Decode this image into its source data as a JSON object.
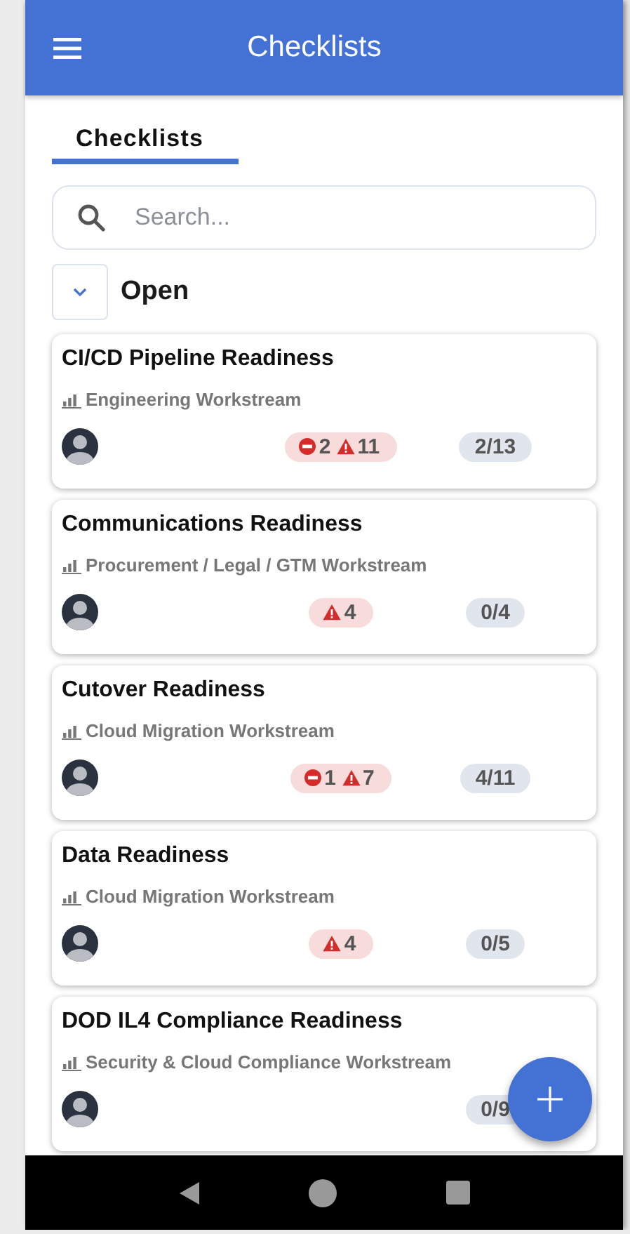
{
  "app_bar": {
    "title": "Checklists"
  },
  "tabs": [
    {
      "label": "Checklists",
      "selected": true
    }
  ],
  "search": {
    "placeholder": "Search..."
  },
  "section": {
    "title": "Open",
    "expanded": true
  },
  "checklists": [
    {
      "title": "CI/CD Pipeline Readiness",
      "workstream": "Engineering Workstream",
      "issues": [
        {
          "kind": "blocked",
          "count": "2"
        },
        {
          "kind": "warning",
          "count": "11"
        }
      ],
      "progress": "2/13"
    },
    {
      "title": "Communications Readiness",
      "workstream": "Procurement / Legal / GTM Workstream",
      "issues": [
        {
          "kind": "warning",
          "count": "4"
        }
      ],
      "progress": "0/4"
    },
    {
      "title": "Cutover Readiness",
      "workstream": "Cloud Migration Workstream",
      "issues": [
        {
          "kind": "blocked",
          "count": "1"
        },
        {
          "kind": "warning",
          "count": "7"
        }
      ],
      "progress": "4/11"
    },
    {
      "title": "Data Readiness",
      "workstream": "Cloud Migration Workstream",
      "issues": [
        {
          "kind": "warning",
          "count": "4"
        }
      ],
      "progress": "0/5"
    },
    {
      "title": "DOD IL4 Compliance Readiness",
      "workstream": "Security & Cloud Compliance Workstream",
      "progress": "0/9"
    }
  ]
}
